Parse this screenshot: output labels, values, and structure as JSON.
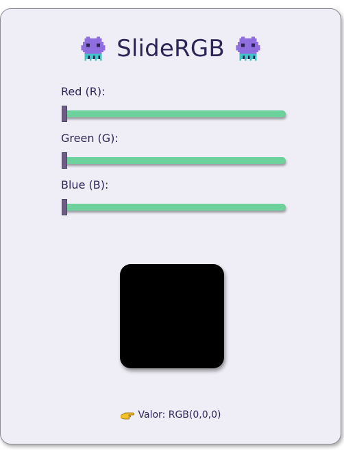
{
  "app": {
    "title": "SlideRGB",
    "monster_icon": "space-invader-monster-icon"
  },
  "sliders": [
    {
      "label": "Red (R):",
      "value": 0,
      "max": 255,
      "channel": "red"
    },
    {
      "label": "Green (G):",
      "value": 0,
      "max": 255,
      "channel": "green"
    },
    {
      "label": "Blue (B):",
      "value": 0,
      "max": 255,
      "channel": "blue"
    }
  ],
  "preview": {
    "color": "#000000"
  },
  "value": {
    "icon": "pointing-hand-icon",
    "text": "Valor: RGB(0,0,0)"
  },
  "colors": {
    "track": "#6cd19a",
    "thumb": "#6e5e86",
    "text": "#2e2456",
    "card": "#efeef6"
  }
}
